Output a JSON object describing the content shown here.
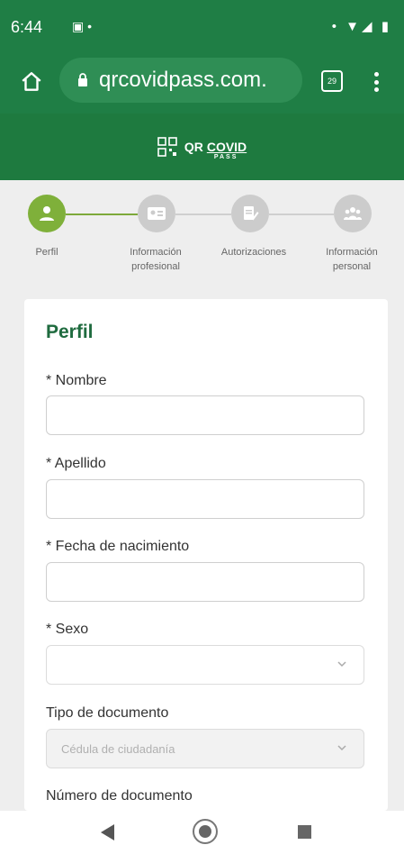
{
  "status_bar": {
    "time": "6:44",
    "left_icons": "▣ •",
    "right_icons": "• ▼◢ ▮"
  },
  "browser": {
    "url": "qrcovidpass.com.",
    "tabs_count": "29"
  },
  "header": {
    "logo_qr": "QR",
    "logo_covid": "COVID",
    "logo_pass": "PASS",
    "brand_color": "#1e7a3f"
  },
  "stepper": {
    "steps": [
      {
        "label": "Perfil",
        "active": true,
        "icon": "user-icon"
      },
      {
        "label": "Información profesional",
        "active": false,
        "icon": "id-card-icon"
      },
      {
        "label": "Autorizaciones",
        "active": false,
        "icon": "document-edit-icon"
      },
      {
        "label": "Información personal",
        "active": false,
        "icon": "group-icon"
      }
    ],
    "active_color": "#7fb03a",
    "inactive_color": "#cccccc"
  },
  "form": {
    "title": "Perfil",
    "fields": {
      "nombre": {
        "label": "* Nombre",
        "value": ""
      },
      "apellido": {
        "label": "* Apellido",
        "value": ""
      },
      "fecha": {
        "label": "* Fecha de nacimiento",
        "value": ""
      },
      "sexo": {
        "label": "* Sexo",
        "value": ""
      },
      "tipo_documento": {
        "label": "Tipo de documento",
        "value": "Cédula de ciudadanía"
      },
      "numero_documento": {
        "label": "Número de documento"
      }
    }
  }
}
